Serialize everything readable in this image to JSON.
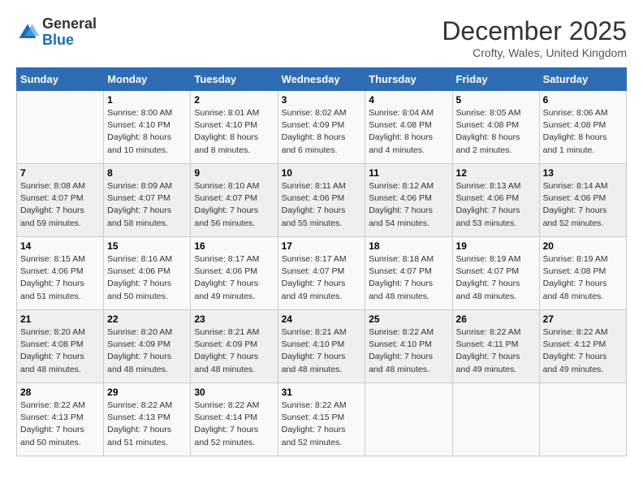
{
  "logo": {
    "general": "General",
    "blue": "Blue"
  },
  "header": {
    "month": "December 2025",
    "location": "Crofty, Wales, United Kingdom"
  },
  "weekdays": [
    "Sunday",
    "Monday",
    "Tuesday",
    "Wednesday",
    "Thursday",
    "Friday",
    "Saturday"
  ],
  "weeks": [
    [
      {
        "day": "",
        "info": ""
      },
      {
        "day": "1",
        "info": "Sunrise: 8:00 AM\nSunset: 4:10 PM\nDaylight: 8 hours\nand 10 minutes."
      },
      {
        "day": "2",
        "info": "Sunrise: 8:01 AM\nSunset: 4:10 PM\nDaylight: 8 hours\nand 8 minutes."
      },
      {
        "day": "3",
        "info": "Sunrise: 8:02 AM\nSunset: 4:09 PM\nDaylight: 8 hours\nand 6 minutes."
      },
      {
        "day": "4",
        "info": "Sunrise: 8:04 AM\nSunset: 4:08 PM\nDaylight: 8 hours\nand 4 minutes."
      },
      {
        "day": "5",
        "info": "Sunrise: 8:05 AM\nSunset: 4:08 PM\nDaylight: 8 hours\nand 2 minutes."
      },
      {
        "day": "6",
        "info": "Sunrise: 8:06 AM\nSunset: 4:08 PM\nDaylight: 8 hours\nand 1 minute."
      }
    ],
    [
      {
        "day": "7",
        "info": "Sunrise: 8:08 AM\nSunset: 4:07 PM\nDaylight: 7 hours\nand 59 minutes."
      },
      {
        "day": "8",
        "info": "Sunrise: 8:09 AM\nSunset: 4:07 PM\nDaylight: 7 hours\nand 58 minutes."
      },
      {
        "day": "9",
        "info": "Sunrise: 8:10 AM\nSunset: 4:07 PM\nDaylight: 7 hours\nand 56 minutes."
      },
      {
        "day": "10",
        "info": "Sunrise: 8:11 AM\nSunset: 4:06 PM\nDaylight: 7 hours\nand 55 minutes."
      },
      {
        "day": "11",
        "info": "Sunrise: 8:12 AM\nSunset: 4:06 PM\nDaylight: 7 hours\nand 54 minutes."
      },
      {
        "day": "12",
        "info": "Sunrise: 8:13 AM\nSunset: 4:06 PM\nDaylight: 7 hours\nand 53 minutes."
      },
      {
        "day": "13",
        "info": "Sunrise: 8:14 AM\nSunset: 4:06 PM\nDaylight: 7 hours\nand 52 minutes."
      }
    ],
    [
      {
        "day": "14",
        "info": "Sunrise: 8:15 AM\nSunset: 4:06 PM\nDaylight: 7 hours\nand 51 minutes."
      },
      {
        "day": "15",
        "info": "Sunrise: 8:16 AM\nSunset: 4:06 PM\nDaylight: 7 hours\nand 50 minutes."
      },
      {
        "day": "16",
        "info": "Sunrise: 8:17 AM\nSunset: 4:06 PM\nDaylight: 7 hours\nand 49 minutes."
      },
      {
        "day": "17",
        "info": "Sunrise: 8:17 AM\nSunset: 4:07 PM\nDaylight: 7 hours\nand 49 minutes."
      },
      {
        "day": "18",
        "info": "Sunrise: 8:18 AM\nSunset: 4:07 PM\nDaylight: 7 hours\nand 48 minutes."
      },
      {
        "day": "19",
        "info": "Sunrise: 8:19 AM\nSunset: 4:07 PM\nDaylight: 7 hours\nand 48 minutes."
      },
      {
        "day": "20",
        "info": "Sunrise: 8:19 AM\nSunset: 4:08 PM\nDaylight: 7 hours\nand 48 minutes."
      }
    ],
    [
      {
        "day": "21",
        "info": "Sunrise: 8:20 AM\nSunset: 4:08 PM\nDaylight: 7 hours\nand 48 minutes."
      },
      {
        "day": "22",
        "info": "Sunrise: 8:20 AM\nSunset: 4:09 PM\nDaylight: 7 hours\nand 48 minutes."
      },
      {
        "day": "23",
        "info": "Sunrise: 8:21 AM\nSunset: 4:09 PM\nDaylight: 7 hours\nand 48 minutes."
      },
      {
        "day": "24",
        "info": "Sunrise: 8:21 AM\nSunset: 4:10 PM\nDaylight: 7 hours\nand 48 minutes."
      },
      {
        "day": "25",
        "info": "Sunrise: 8:22 AM\nSunset: 4:10 PM\nDaylight: 7 hours\nand 48 minutes."
      },
      {
        "day": "26",
        "info": "Sunrise: 8:22 AM\nSunset: 4:11 PM\nDaylight: 7 hours\nand 49 minutes."
      },
      {
        "day": "27",
        "info": "Sunrise: 8:22 AM\nSunset: 4:12 PM\nDaylight: 7 hours\nand 49 minutes."
      }
    ],
    [
      {
        "day": "28",
        "info": "Sunrise: 8:22 AM\nSunset: 4:13 PM\nDaylight: 7 hours\nand 50 minutes."
      },
      {
        "day": "29",
        "info": "Sunrise: 8:22 AM\nSunset: 4:13 PM\nDaylight: 7 hours\nand 51 minutes."
      },
      {
        "day": "30",
        "info": "Sunrise: 8:22 AM\nSunset: 4:14 PM\nDaylight: 7 hours\nand 52 minutes."
      },
      {
        "day": "31",
        "info": "Sunrise: 8:22 AM\nSunset: 4:15 PM\nDaylight: 7 hours\nand 52 minutes."
      },
      {
        "day": "",
        "info": ""
      },
      {
        "day": "",
        "info": ""
      },
      {
        "day": "",
        "info": ""
      }
    ]
  ]
}
